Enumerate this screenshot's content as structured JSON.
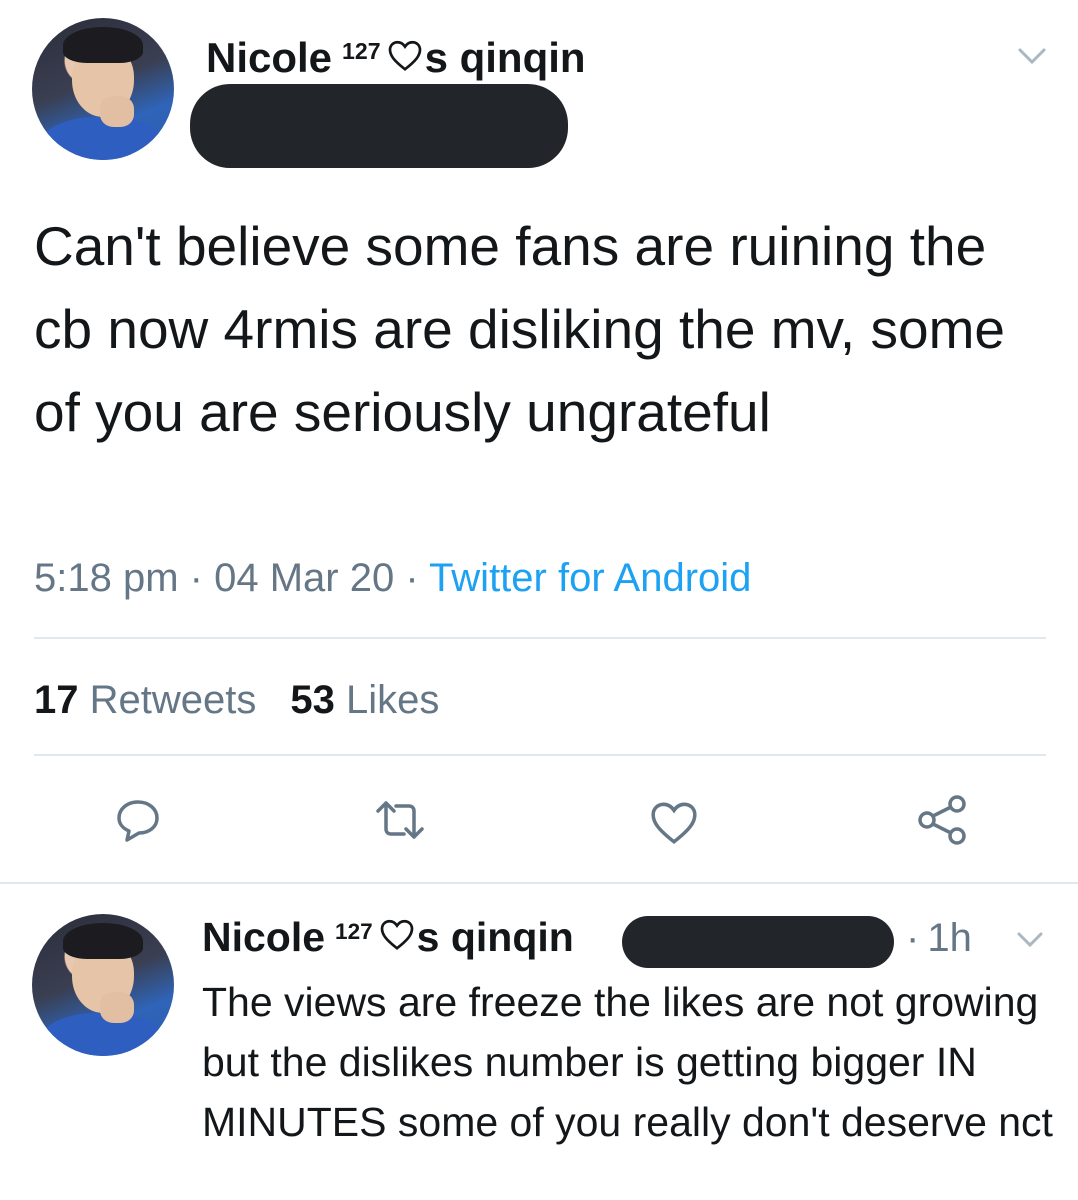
{
  "tweet": {
    "author_name": "Nicole",
    "author_sup": "127",
    "author_suffix": "s qinqin",
    "text": "Can't believe some fans are ruining the cb now 4rmis are disliking the mv, some of you are seriously ungrateful",
    "time": "5:18 pm",
    "date": "04 Mar 20",
    "source": "Twitter for Android",
    "separator": "·",
    "retweets_count": "17",
    "retweets_label": "Retweets",
    "likes_count": "53",
    "likes_label": "Likes"
  },
  "actions": [
    {
      "icon": "reply-icon"
    },
    {
      "icon": "retweet-icon"
    },
    {
      "icon": "like-icon"
    },
    {
      "icon": "share-icon"
    }
  ],
  "reply": {
    "author_name": "Nicole",
    "author_sup": "127",
    "author_suffix": "s qinqin",
    "time_sep": "·",
    "time": "1h",
    "text": "The views are freeze the likes are not growing but the dislikes number is getting bigger IN MINUTES some of you really don't deserve nct"
  },
  "colors": {
    "text": "#14171a",
    "muted": "#657786",
    "link": "#1da1f2",
    "divider": "#e1e8ed",
    "redaction": "#22262b"
  }
}
